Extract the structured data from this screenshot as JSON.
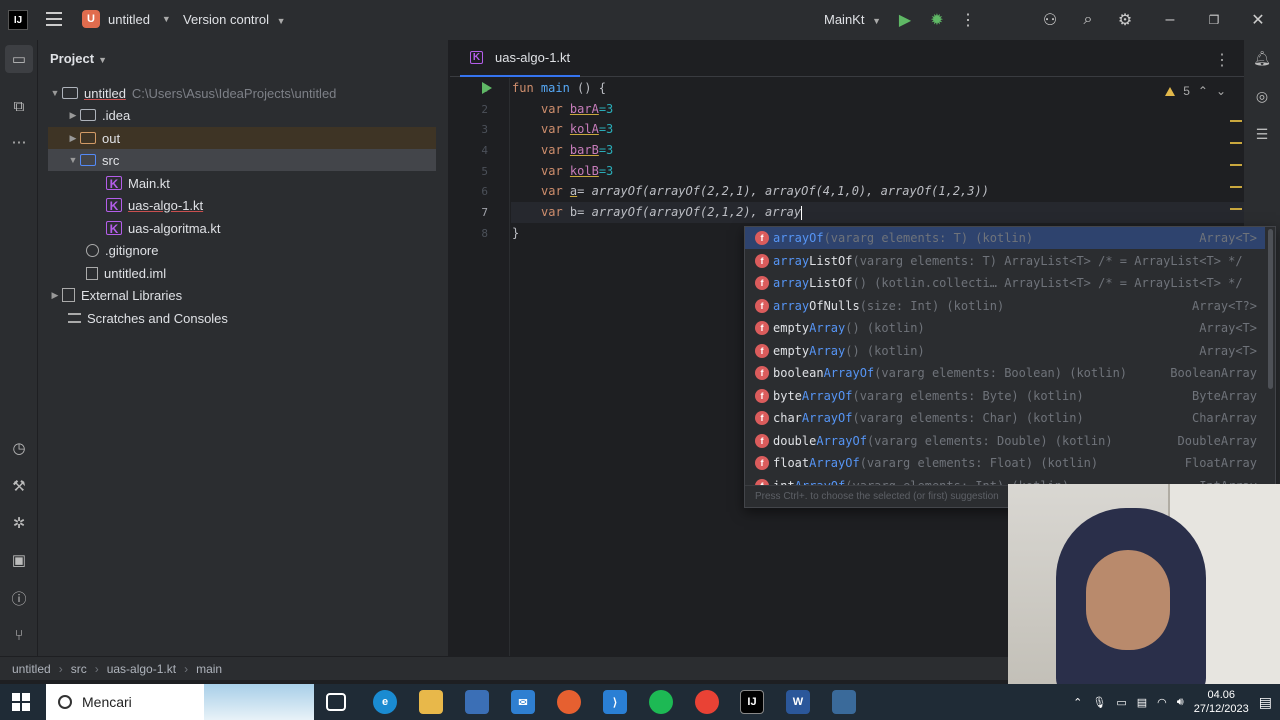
{
  "titlebar": {
    "logo": "IJ",
    "project_badge": "U",
    "project_name": "untitled",
    "vcs_label": "Version control",
    "run_config": "MainKt"
  },
  "project_panel": {
    "title": "Project",
    "tree": [
      {
        "label": "untitled",
        "path": "C:\\Users\\Asus\\IdeaProjects\\untitled"
      },
      {
        "label": ".idea"
      },
      {
        "label": "out"
      },
      {
        "label": "src"
      },
      {
        "label": "Main.kt"
      },
      {
        "label": "uas-algo-1.kt"
      },
      {
        "label": "uas-algoritma.kt"
      },
      {
        "label": ".gitignore"
      },
      {
        "label": "untitled.iml"
      },
      {
        "label": "External Libraries"
      },
      {
        "label": "Scratches and Consoles"
      }
    ]
  },
  "editor": {
    "tab_label": "uas-algo-1.kt",
    "warning_count": "5",
    "line_numbers": [
      "1",
      "2",
      "3",
      "4",
      "5",
      "6",
      "7",
      "8"
    ],
    "code": {
      "l1_kw": "fun",
      "l1_fn": "main",
      "l1_rest": " () {",
      "l2_kw": "var",
      "l2_var": "barA",
      "l2_rest": "=3",
      "l3_kw": "var",
      "l3_var": "kolA",
      "l3_rest": "=3",
      "l4_kw": "var",
      "l4_var": "barB",
      "l4_rest": "=3",
      "l5_kw": "var",
      "l5_var": "kolB",
      "l5_rest": "=3",
      "l6_kw": "var",
      "l6_var": "a",
      "l6_rest": "= arrayOf(arrayOf(2,2,1), arrayOf(4,1,0), arrayOf(1,2,3))",
      "l7_kw": "var",
      "l7_var": "b",
      "l7_rest": "= arrayOf(arrayOf(2,1,2), array",
      "l8": "}"
    }
  },
  "autocomplete": {
    "items": [
      {
        "pre": "",
        "hl": "arrayOf",
        "post": "",
        "sig": "(vararg elements: T) (kotlin)",
        "type": "Array<T>"
      },
      {
        "pre": "",
        "hl": "array",
        "post": "ListOf",
        "sig": "(vararg elements: T) ArrayList<T> /* = ArrayList<T> */",
        "type": ""
      },
      {
        "pre": "",
        "hl": "array",
        "post": "ListOf",
        "sig": "() (kotlin.collecti… ArrayList<T> /* = ArrayList<T> */",
        "type": ""
      },
      {
        "pre": "",
        "hl": "array",
        "post": "OfNulls",
        "sig": "(size: Int) (kotlin)",
        "type": "Array<T?>"
      },
      {
        "pre": "empty",
        "hl": "Array",
        "post": "",
        "sig": "() (kotlin)",
        "type": "Array<T>"
      },
      {
        "pre": "empty",
        "hl": "Array",
        "post": "",
        "sig": "() (kotlin)",
        "type": "Array<T>"
      },
      {
        "pre": "boolean",
        "hl": "ArrayOf",
        "post": "",
        "sig": "(vararg elements: Boolean) (kotlin)",
        "type": "BooleanArray"
      },
      {
        "pre": "byte",
        "hl": "ArrayOf",
        "post": "",
        "sig": "(vararg elements: Byte) (kotlin)",
        "type": "ByteArray"
      },
      {
        "pre": "char",
        "hl": "ArrayOf",
        "post": "",
        "sig": "(vararg elements: Char) (kotlin)",
        "type": "CharArray"
      },
      {
        "pre": "double",
        "hl": "ArrayOf",
        "post": "",
        "sig": "(vararg elements: Double) (kotlin)",
        "type": "DoubleArray"
      },
      {
        "pre": "float",
        "hl": "ArrayOf",
        "post": "",
        "sig": "(vararg elements: Float) (kotlin)",
        "type": "FloatArray"
      },
      {
        "pre": "int",
        "hl": "ArrayOf",
        "post": "",
        "sig": "(vararg elements: Int) (kotlin)",
        "type": "IntArray"
      }
    ],
    "footer": "Press Ctrl+. to choose the selected (or first) suggestion"
  },
  "statusbar": {
    "crumbs": [
      "untitled",
      "src",
      "uas-algo-1.kt",
      "main"
    ]
  },
  "taskbar": {
    "search_label": "Mencari",
    "time": "04.06",
    "date": "27/12/2023"
  }
}
